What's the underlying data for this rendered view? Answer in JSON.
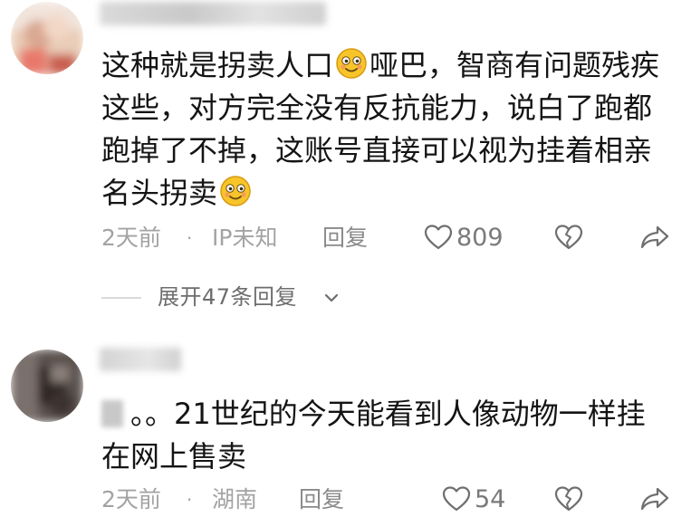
{
  "comments": [
    {
      "text_part1": "这种就是拐卖人口",
      "text_part2": "哑巴，智商有问题残疾这些，对方完全没有反抗能力，说白了跑都跑掉了不掉，这账号直接可以视为挂着相亲名头拐卖",
      "emoji": "smile-emoji",
      "time": "2天前",
      "separator": "·",
      "location": "IP未知",
      "reply_label": "回复",
      "like_count": "809",
      "expand_label": "展开47条回复"
    },
    {
      "text": "。。21世纪的今天能看到人像动物一样挂在网上售卖",
      "time": "2天前",
      "separator": "·",
      "location": "湖南",
      "reply_label": "回复",
      "like_count": "54"
    }
  ],
  "icons": [
    "heart-icon",
    "dislike-heart-icon",
    "share-icon",
    "chevron-down-icon",
    "smile-emoji"
  ]
}
